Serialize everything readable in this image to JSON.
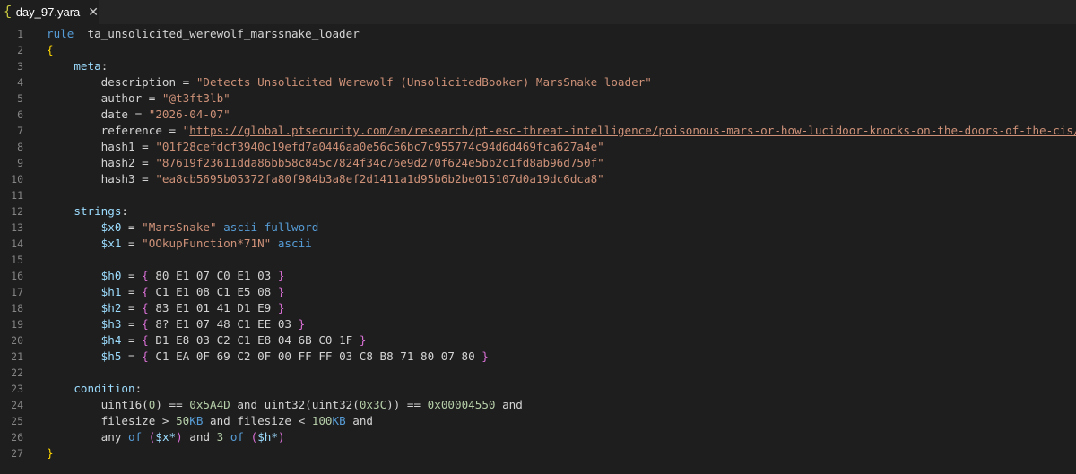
{
  "tab": {
    "icon": "{",
    "title": "day_97.yara",
    "close": "✕"
  },
  "lines": [
    {
      "n": "1",
      "t": [
        [
          "kw",
          "rule"
        ],
        [
          "",
          "  "
        ],
        [
          "",
          "ta_unsolicited_werewolf_marssnake_loader"
        ]
      ]
    },
    {
      "n": "2",
      "t": [
        [
          "br1",
          "{"
        ]
      ]
    },
    {
      "n": "3",
      "t": [
        [
          "",
          "    "
        ],
        [
          "meta",
          "meta"
        ],
        [
          "",
          ":"
        ]
      ]
    },
    {
      "n": "4",
      "t": [
        [
          "",
          "        "
        ],
        [
          "",
          "description = "
        ],
        [
          "str",
          "\"Detects Unsolicited Werewolf (UnsolicitedBooker) MarsSnake loader\""
        ]
      ]
    },
    {
      "n": "5",
      "t": [
        [
          "",
          "        "
        ],
        [
          "",
          "author = "
        ],
        [
          "str",
          "\"@t3ft3lb\""
        ]
      ]
    },
    {
      "n": "6",
      "t": [
        [
          "",
          "        "
        ],
        [
          "",
          "date = "
        ],
        [
          "str",
          "\"2026-04-07\""
        ]
      ]
    },
    {
      "n": "7",
      "t": [
        [
          "",
          "        "
        ],
        [
          "",
          "reference = "
        ],
        [
          "str",
          "\""
        ],
        [
          "url",
          "https://global.ptsecurity.com/en/research/pt-esc-threat-intelligence/poisonous-mars-or-how-lucidoor-knocks-on-the-doors-of-the-cis/"
        ],
        [
          "str",
          "\""
        ]
      ]
    },
    {
      "n": "8",
      "t": [
        [
          "",
          "        "
        ],
        [
          "",
          "hash1 = "
        ],
        [
          "str",
          "\"01f28cefdcf3940c19efd7a0446aa0e56c56bc7c955774c94d6d469fca627a4e\""
        ]
      ]
    },
    {
      "n": "9",
      "t": [
        [
          "",
          "        "
        ],
        [
          "",
          "hash2 = "
        ],
        [
          "str",
          "\"87619f23611dda86bb58c845c7824f34c76e9d270f624e5bb2c1fd8ab96d750f\""
        ]
      ]
    },
    {
      "n": "10",
      "t": [
        [
          "",
          "        "
        ],
        [
          "",
          "hash3 = "
        ],
        [
          "str",
          "\"ea8cb5695b05372fa80f984b3a8ef2d1411a1d95b6b2be015107d0a19dc6dca8\""
        ]
      ]
    },
    {
      "n": "11",
      "t": []
    },
    {
      "n": "12",
      "t": [
        [
          "",
          "    "
        ],
        [
          "meta",
          "strings"
        ],
        [
          "",
          ":"
        ]
      ]
    },
    {
      "n": "13",
      "t": [
        [
          "",
          "        "
        ],
        [
          "var",
          "$x0"
        ],
        [
          "",
          " = "
        ],
        [
          "str",
          "\"MarsSnake\""
        ],
        [
          "",
          " "
        ],
        [
          "kw",
          "ascii"
        ],
        [
          "",
          " "
        ],
        [
          "kw",
          "fullword"
        ]
      ]
    },
    {
      "n": "14",
      "t": [
        [
          "",
          "        "
        ],
        [
          "var",
          "$x1"
        ],
        [
          "",
          " = "
        ],
        [
          "str",
          "\"OOkupFunction*71N\""
        ],
        [
          "",
          " "
        ],
        [
          "kw",
          "ascii"
        ]
      ]
    },
    {
      "n": "15",
      "t": []
    },
    {
      "n": "16",
      "t": [
        [
          "",
          "        "
        ],
        [
          "var",
          "$h0"
        ],
        [
          "",
          " = "
        ],
        [
          "br2",
          "{"
        ],
        [
          "hex",
          " 80 E1 07 C0 E1 03 "
        ],
        [
          "br2",
          "}"
        ]
      ]
    },
    {
      "n": "17",
      "t": [
        [
          "",
          "        "
        ],
        [
          "var",
          "$h1"
        ],
        [
          "",
          " = "
        ],
        [
          "br2",
          "{"
        ],
        [
          "hex",
          " C1 E1 08 C1 E5 08 "
        ],
        [
          "br2",
          "}"
        ]
      ]
    },
    {
      "n": "18",
      "t": [
        [
          "",
          "        "
        ],
        [
          "var",
          "$h2"
        ],
        [
          "",
          " = "
        ],
        [
          "br2",
          "{"
        ],
        [
          "hex",
          " 83 E1 01 41 D1 E9 "
        ],
        [
          "br2",
          "}"
        ]
      ]
    },
    {
      "n": "19",
      "t": [
        [
          "",
          "        "
        ],
        [
          "var",
          "$h3"
        ],
        [
          "",
          " = "
        ],
        [
          "br2",
          "{"
        ],
        [
          "hex",
          " 8? E1 07 48 C1 EE 03 "
        ],
        [
          "br2",
          "}"
        ]
      ]
    },
    {
      "n": "20",
      "t": [
        [
          "",
          "        "
        ],
        [
          "var",
          "$h4"
        ],
        [
          "",
          " = "
        ],
        [
          "br2",
          "{"
        ],
        [
          "hex",
          " D1 E8 03 C2 C1 E8 04 6B C0 1F "
        ],
        [
          "br2",
          "}"
        ]
      ]
    },
    {
      "n": "21",
      "t": [
        [
          "",
          "        "
        ],
        [
          "var",
          "$h5"
        ],
        [
          "",
          " = "
        ],
        [
          "br2",
          "{"
        ],
        [
          "hex",
          " C1 EA 0F 69 C2 0F 00 FF FF 03 C8 B8 71 80 07 80 "
        ],
        [
          "br2",
          "}"
        ]
      ]
    },
    {
      "n": "22",
      "t": []
    },
    {
      "n": "23",
      "t": [
        [
          "",
          "    "
        ],
        [
          "meta",
          "condition"
        ],
        [
          "",
          ":"
        ]
      ]
    },
    {
      "n": "24",
      "t": [
        [
          "",
          "        "
        ],
        [
          "",
          "uint16("
        ],
        [
          "num",
          "0"
        ],
        [
          "",
          ") == "
        ],
        [
          "num",
          "0x5A4D"
        ],
        [
          "",
          " and uint32(uint32("
        ],
        [
          "num",
          "0x3C"
        ],
        [
          "",
          ")) == "
        ],
        [
          "num",
          "0x00004550"
        ],
        [
          "",
          " and"
        ]
      ]
    },
    {
      "n": "25",
      "t": [
        [
          "",
          "        "
        ],
        [
          "",
          "filesize > "
        ],
        [
          "num",
          "50"
        ],
        [
          "kw",
          "KB"
        ],
        [
          "",
          " and filesize < "
        ],
        [
          "num",
          "100"
        ],
        [
          "kw",
          "KB"
        ],
        [
          "",
          " and"
        ]
      ]
    },
    {
      "n": "26",
      "t": [
        [
          "",
          "        "
        ],
        [
          "",
          "any "
        ],
        [
          "kw",
          "of"
        ],
        [
          "",
          " "
        ],
        [
          "br2",
          "("
        ],
        [
          "var",
          "$x*"
        ],
        [
          "br2",
          ")"
        ],
        [
          "",
          " and "
        ],
        [
          "num",
          "3"
        ],
        [
          "",
          " "
        ],
        [
          "kw",
          "of"
        ],
        [
          "",
          " "
        ],
        [
          "br2",
          "("
        ],
        [
          "var",
          "$h*"
        ],
        [
          "br2",
          ")"
        ]
      ]
    },
    {
      "n": "27",
      "t": [
        [
          "br1",
          "}"
        ]
      ]
    }
  ]
}
